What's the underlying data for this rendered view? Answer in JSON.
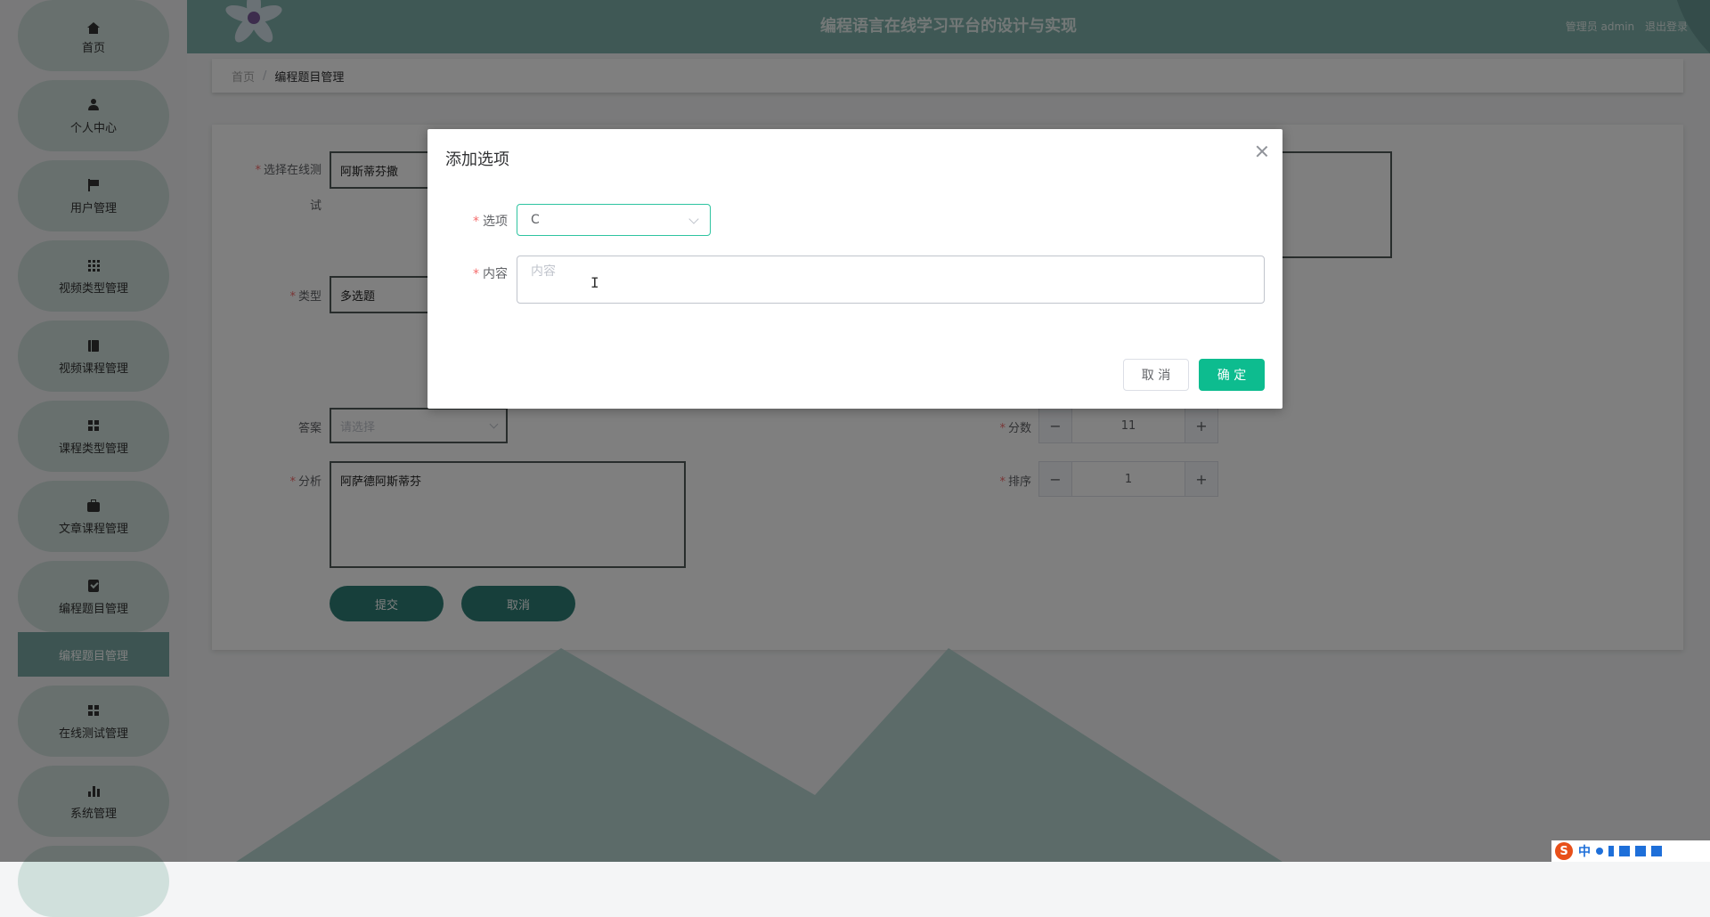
{
  "app": {
    "title": "编程语言在线学习平台的设计与实现"
  },
  "header": {
    "user_label": "管理员 admin",
    "logout_label": "退出登录"
  },
  "sidebar": {
    "items": [
      {
        "label": "首页",
        "icon": "home-icon"
      },
      {
        "label": "个人中心",
        "icon": "user-icon"
      },
      {
        "label": "用户管理",
        "icon": "flag-icon"
      },
      {
        "label": "视频类型管理",
        "icon": "grid-icon"
      },
      {
        "label": "视频课程管理",
        "icon": "book-icon"
      },
      {
        "label": "课程类型管理",
        "icon": "apps-icon"
      },
      {
        "label": "文章课程管理",
        "icon": "briefcase-icon"
      },
      {
        "label": "编程题目管理",
        "icon": "clipboard-icon"
      },
      {
        "label": "在线测试管理",
        "icon": "apps-icon"
      },
      {
        "label": "系统管理",
        "icon": "bar-chart-icon"
      }
    ],
    "active_sub_item": "编程题目管理"
  },
  "breadcrumb": {
    "home": "首页",
    "separator": "/",
    "current": "编程题目管理"
  },
  "form": {
    "test_label_line1": "选择在线测",
    "test_label_line2": "试",
    "test_value": "阿斯蒂芬撒",
    "type_label": "类型",
    "type_value": "多选题",
    "answer_label": "答案",
    "answer_placeholder": "请选择",
    "analysis_label": "分析",
    "analysis_value": "阿萨德阿斯蒂芬",
    "score_label": "分数",
    "score_value": "11",
    "order_label": "排序",
    "order_value": "1",
    "submit_label": "提交",
    "cancel_label": "取消"
  },
  "dialog": {
    "title": "添加选项",
    "option_label": "选项",
    "option_value": "C",
    "content_label": "内容",
    "content_placeholder": "内容",
    "cancel_label": "取 消",
    "confirm_label": "确 定"
  },
  "ime": {
    "text": "中"
  },
  "colors": {
    "header_bg": "#7fb1ab",
    "sidebar_item_bg": "#d0e0dc",
    "active_sub_bg": "#7aa9a4",
    "confirm_green": "#0dbc8f",
    "form_button": "#2f7f77"
  }
}
